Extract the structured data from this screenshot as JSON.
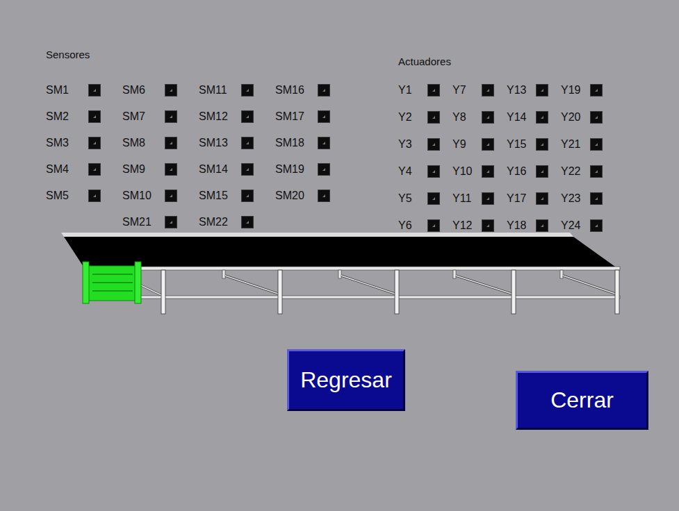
{
  "sensors": {
    "title": "Sensores",
    "columns": [
      [
        {
          "label": "SM1",
          "on": false
        },
        {
          "label": "SM2",
          "on": false
        },
        {
          "label": "SM3",
          "on": false
        },
        {
          "label": "SM4",
          "on": false
        },
        {
          "label": "SM5",
          "on": false
        }
      ],
      [
        {
          "label": "SM6",
          "on": false
        },
        {
          "label": "SM7",
          "on": false
        },
        {
          "label": "SM8",
          "on": false
        },
        {
          "label": "SM9",
          "on": false
        },
        {
          "label": "SM10",
          "on": false
        },
        {
          "label": "SM21",
          "on": false
        }
      ],
      [
        {
          "label": "SM11",
          "on": false
        },
        {
          "label": "SM12",
          "on": false
        },
        {
          "label": "SM13",
          "on": false
        },
        {
          "label": "SM14",
          "on": false
        },
        {
          "label": "SM15",
          "on": false
        },
        {
          "label": "SM22",
          "on": false
        }
      ],
      [
        {
          "label": "SM16",
          "on": false
        },
        {
          "label": "SM17",
          "on": false
        },
        {
          "label": "SM18",
          "on": false
        },
        {
          "label": "SM19",
          "on": false
        },
        {
          "label": "SM20",
          "on": false
        }
      ]
    ]
  },
  "actuators": {
    "title": "Actuadores",
    "columns": [
      [
        {
          "label": "Y1",
          "on": false
        },
        {
          "label": "Y2",
          "on": false
        },
        {
          "label": "Y3",
          "on": false
        },
        {
          "label": "Y4",
          "on": false
        },
        {
          "label": "Y5",
          "on": false
        },
        {
          "label": "Y6",
          "on": false
        }
      ],
      [
        {
          "label": "Y7",
          "on": false
        },
        {
          "label": "Y8",
          "on": false
        },
        {
          "label": "Y9",
          "on": false
        },
        {
          "label": "Y10",
          "on": false
        },
        {
          "label": "Y11",
          "on": false
        },
        {
          "label": "Y12",
          "on": false
        }
      ],
      [
        {
          "label": "Y13",
          "on": false
        },
        {
          "label": "Y14",
          "on": false
        },
        {
          "label": "Y15",
          "on": false
        },
        {
          "label": "Y16",
          "on": false
        },
        {
          "label": "Y17",
          "on": false
        },
        {
          "label": "Y18",
          "on": false
        }
      ],
      [
        {
          "label": "Y19",
          "on": false
        },
        {
          "label": "Y20",
          "on": false
        },
        {
          "label": "Y21",
          "on": false
        },
        {
          "label": "Y22",
          "on": false
        },
        {
          "label": "Y23",
          "on": false
        },
        {
          "label": "Y24",
          "on": false
        }
      ]
    ]
  },
  "conveyor": {
    "box": {
      "visible": true,
      "level": 0
    }
  },
  "buttons": [
    {
      "label": "Regresar"
    },
    {
      "label": "Cerrar"
    }
  ]
}
